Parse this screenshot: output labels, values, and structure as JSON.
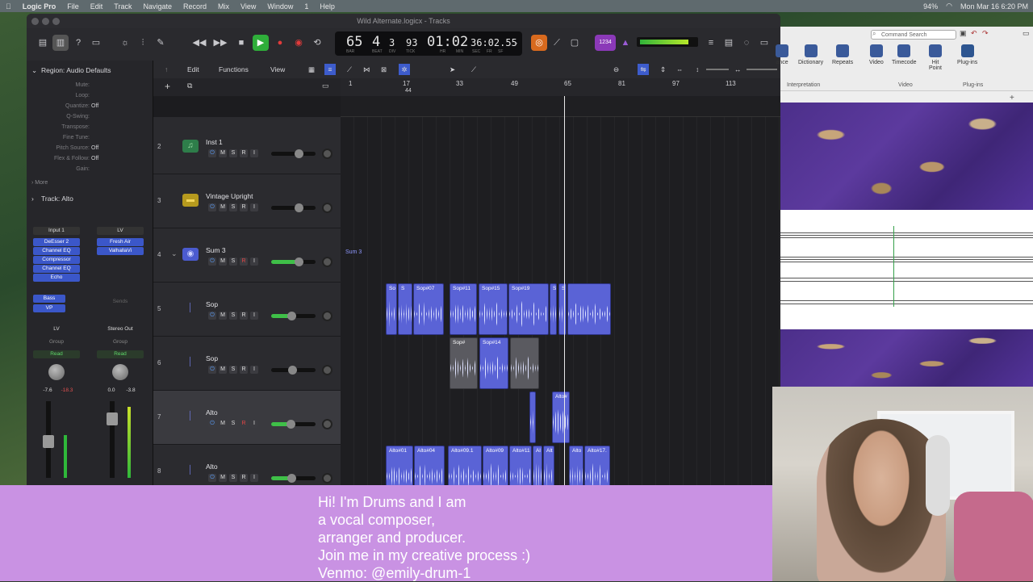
{
  "menubar": {
    "items": [
      "Logic Pro",
      "File",
      "Edit",
      "Track",
      "Navigate",
      "Record",
      "Mix",
      "View",
      "Window",
      "1",
      "Help"
    ],
    "battery": "94%",
    "datetime": "Mon Mar 16  6:20 PM"
  },
  "window": {
    "title": "Wild Alternate.logicx - Tracks"
  },
  "lcd": {
    "bar": "65",
    "beat": "4",
    "div": "3",
    "tick": "93",
    "time": "01:02",
    "sub": "36:02.55",
    "labels": [
      "BAR",
      "BEAT",
      "DIV",
      "TICK",
      "HR",
      "MIN",
      "SEC",
      "FR",
      "SF"
    ]
  },
  "key_badge": "1234",
  "inspector": {
    "region_header": "Region: Audio Defaults",
    "params": [
      {
        "k": "Mute:",
        "v": ""
      },
      {
        "k": "Loop:",
        "v": ""
      },
      {
        "k": "Quantize:",
        "v": "Off"
      },
      {
        "k": "Q-Swing:",
        "v": ""
      },
      {
        "k": "Transpose:",
        "v": ""
      },
      {
        "k": "Fine Tune:",
        "v": ""
      },
      {
        "k": "Pitch Source:",
        "v": "Off"
      },
      {
        "k": "Flex & Follow:",
        "v": "Off"
      },
      {
        "k": "Gain:",
        "v": ""
      }
    ],
    "more": "More",
    "track_header": "Track: Alto",
    "strip1": {
      "input": "Input 1",
      "plugins": [
        "DeEsser 2",
        "Channel EQ",
        "Compressor",
        "Channel EQ",
        "Echo"
      ],
      "sends": [
        "Bass",
        "VP"
      ],
      "output": "LV",
      "group": "Group",
      "automation": "Read",
      "vol1": "-7.6",
      "vol2": "-18.3"
    },
    "strip2": {
      "input": "LV",
      "plugins": [
        "Fresh Air",
        "ValhallaVi"
      ],
      "sends_label": "Sends",
      "output": "Stereo Out",
      "group": "Group",
      "automation": "Read",
      "vol1": "0.0",
      "vol2": "-3.8"
    }
  },
  "toolbar": {
    "edit": "Edit",
    "functions": "Functions",
    "view": "View"
  },
  "ruler": {
    "marks": [
      "1",
      "17",
      "33",
      "49",
      "65",
      "81",
      "97",
      "113"
    ],
    "sub": "44"
  },
  "tracks": [
    {
      "num": "2",
      "name": "Inst 1"
    },
    {
      "num": "3",
      "name": "Vintage Upright"
    },
    {
      "num": "4",
      "name": "Sum 3"
    },
    {
      "num": "5",
      "name": "Sop"
    },
    {
      "num": "6",
      "name": "Sop"
    },
    {
      "num": "7",
      "name": "Alto"
    },
    {
      "num": "8",
      "name": "Alto"
    }
  ],
  "track_buttons": {
    "m": "M",
    "s": "S",
    "r": "R",
    "i": "I"
  },
  "regions": {
    "sum_label": "Sum 3",
    "row5": [
      "So",
      "S",
      "Sop#07",
      "Sop#11",
      "Sop#15",
      "Sop#19",
      "S",
      "S"
    ],
    "row6": [
      "Sop#",
      "Sop#14"
    ],
    "row7": [
      "Alto#"
    ],
    "row8": [
      "Alto#01",
      "Alto#04",
      "Alto#09.1",
      "Alto#09",
      "Alto#11",
      "Al",
      "Alt",
      "Alto",
      "Alto#17."
    ]
  },
  "score": {
    "search_placeholder": "Command Search",
    "ribbon": [
      "ance",
      "Dictionary",
      "Repeats",
      "Video",
      "Timecode",
      "Hit Point",
      "Plug-ins"
    ],
    "groups": [
      "Interpretation",
      "Video",
      "Plug-ins"
    ]
  },
  "banner": {
    "lines": [
      "Hi! I'm Drums and I am",
      "a vocal composer,",
      "arranger and producer.",
      "Join me in my creative process :)",
      "Venmo: @emily-drum-1"
    ]
  }
}
